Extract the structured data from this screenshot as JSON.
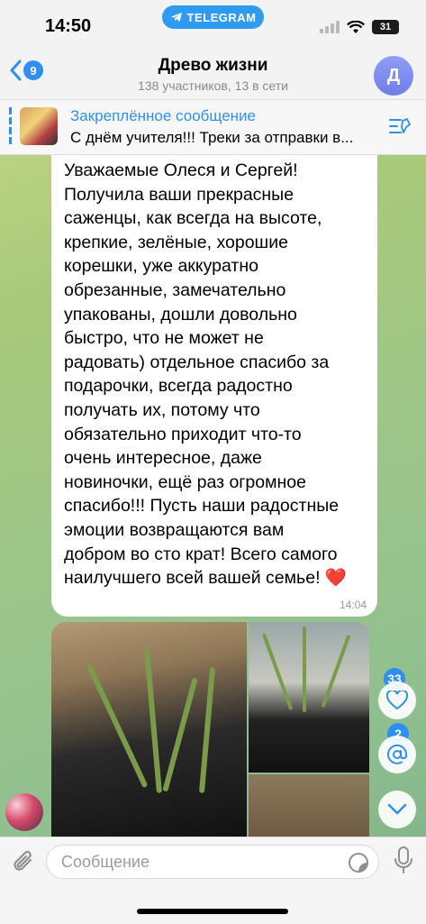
{
  "status_bar": {
    "time": "14:50",
    "app_pill": "TELEGRAM",
    "battery": "31"
  },
  "header": {
    "back_count": "9",
    "title": "Древо жизни",
    "subtitle": "138 участников, 13 в сети",
    "avatar_letter": "Д"
  },
  "pinned": {
    "title": "Закреплённое сообщение",
    "text": "С днём учителя!!! Треки за отправки в..."
  },
  "message": {
    "text": "Уважаемые Олеся и Сергей!\nПолучила ваши прекрасные\nсаженцы, как всегда на высоте,\nкрепкие, зелёные, хорошие\nкорешки, уже аккуратно\nобрезанные, замечательно\nупакованы, дошли довольно\nбыстро, что не может не\nрадовать) отдельное спасибо за\nподарочки, всегда радостно\nполучать их, потому что\nобязательно приходит что-то\nочень интересное, даже\nновиночки, ещё раз огромное\nспасибо!!! Пусть наши радостные\nэмоции возвращаются вам\nдобром во сто крат! Всего самого\nнаилучшего всей вашей семье! ❤️",
    "time": "14:04"
  },
  "side_buttons": {
    "reactions_count": "33",
    "mentions_count": "2"
  },
  "input": {
    "placeholder": "Сообщение"
  },
  "colors": {
    "accent": "#2f8ff0",
    "badge": "#2f8ff0",
    "heart": "#e02a2a"
  }
}
